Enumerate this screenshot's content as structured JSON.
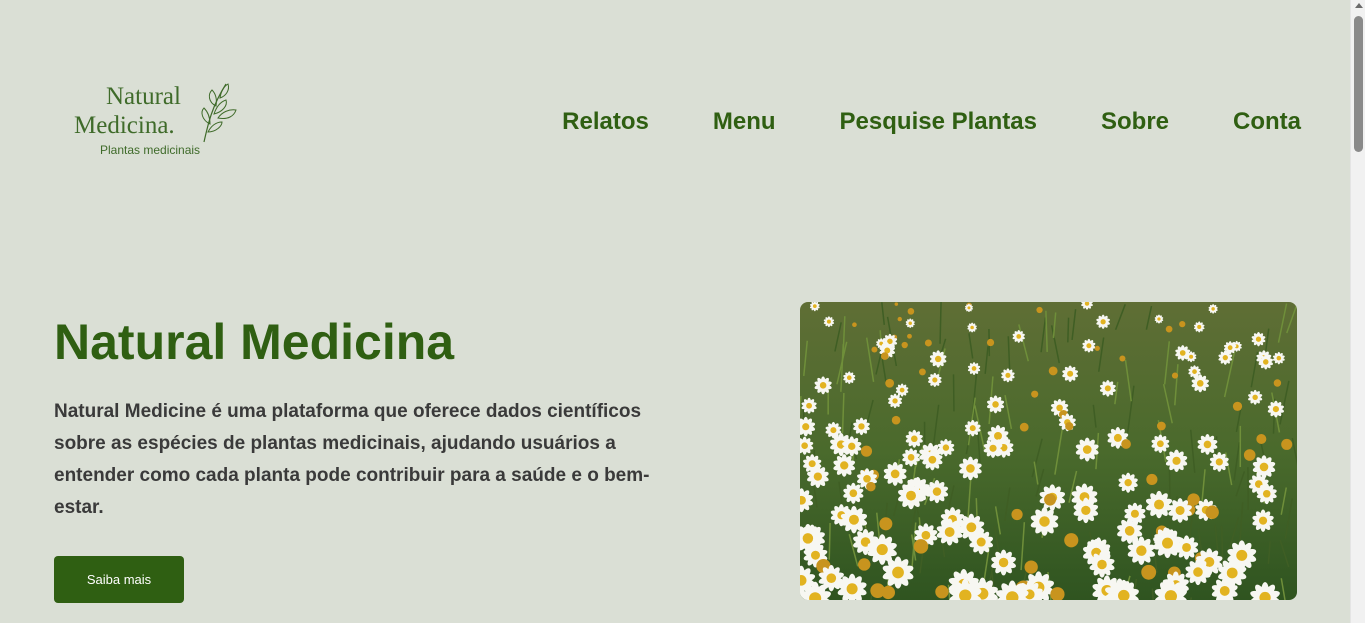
{
  "logo": {
    "line1": "Natural",
    "line2": "Medicina.",
    "tagline": "Plantas medicinais"
  },
  "nav": {
    "items": [
      "Relatos",
      "Menu",
      "Pesquise Plantas",
      "Sobre",
      "Conta"
    ]
  },
  "hero": {
    "title": "Natural Medicina",
    "description": "Natural Medicine é uma plataforma que oferece dados científicos sobre as espécies de plantas medicinais, ajudando usuários a entender como cada planta pode contribuir para a saúde e o bem-estar.",
    "cta_label": "Saiba mais",
    "image_alt": "chamomile-field-photo"
  },
  "colors": {
    "background": "#dadfd5",
    "brand_green": "#2f5f12",
    "text_dark": "#3a3a3a"
  }
}
